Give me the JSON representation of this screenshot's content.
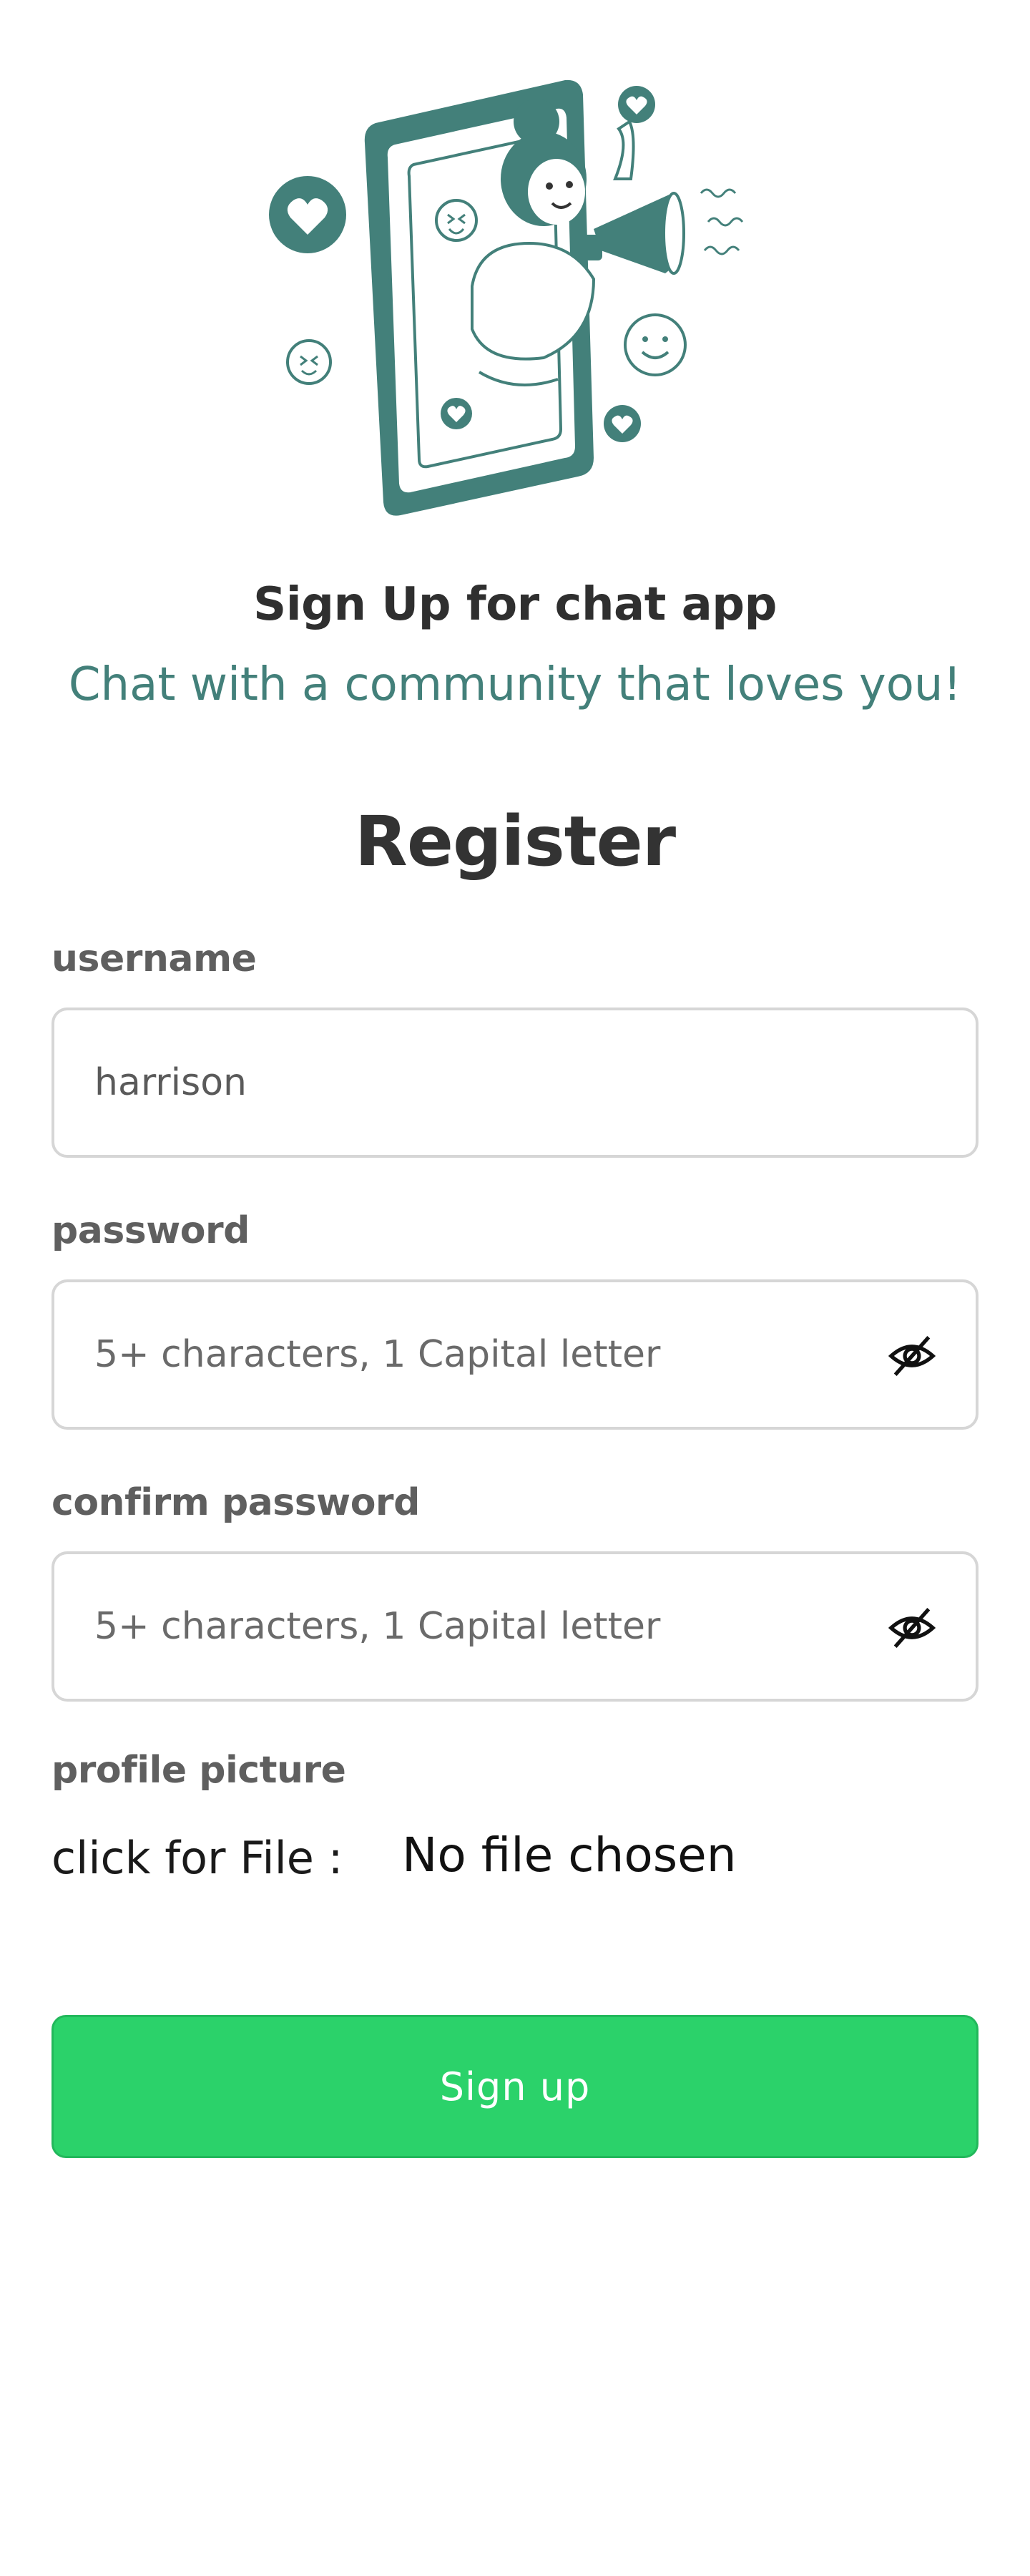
{
  "header": {
    "title": "Sign Up for chat app",
    "subtitle": "Chat with a community that loves you!"
  },
  "form": {
    "title": "Register",
    "username": {
      "label": "username",
      "value": "harrison"
    },
    "password": {
      "label": "password",
      "placeholder": "5+ characters, 1 Capital letter"
    },
    "confirm_password": {
      "label": "confirm password",
      "placeholder": "5+ characters, 1 Capital letter"
    },
    "profile_picture": {
      "label": "profile picture",
      "button_label": "click for File :",
      "status": "No file chosen"
    },
    "submit_label": "Sign up"
  },
  "icons": {
    "hero": "phone-megaphone-illustration",
    "password_toggle": "eye-off-icon"
  },
  "colors": {
    "accent_teal": "#43807a",
    "button_green": "#2bd26a",
    "heading": "#2f2f2f"
  }
}
